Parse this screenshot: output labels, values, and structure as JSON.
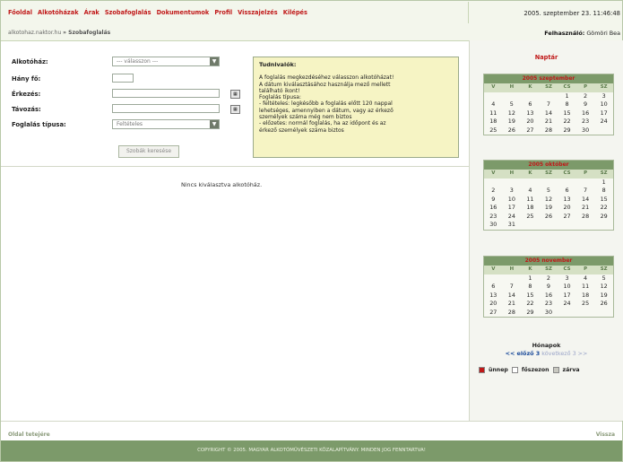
{
  "nav": {
    "items": [
      "Főoldal",
      "Alkotóházak",
      "Árak",
      "Szobafoglalás",
      "Dokumentumok",
      "Profil",
      "Visszajelzés",
      "Kilépés"
    ],
    "datetime": "2005. szeptember 23. 11:46:48"
  },
  "breadcrumb": {
    "path": "alkotohaz.naktor.hu",
    "current": "» Szobafoglalás"
  },
  "user": {
    "label": "Felhasználó:",
    "name": "Gömöri Bea"
  },
  "form": {
    "alkotohaz_label": "Alkotóház:",
    "alkotohaz_value": "--- válasszon ---",
    "hany_fo_label": "Hány fő:",
    "erkezes_label": "Érkezés:",
    "tavozas_label": "Távozás:",
    "foglalas_label": "Foglalás típusa:",
    "foglalas_value": "Feltételes",
    "search_button": "Szobák keresése"
  },
  "info": {
    "title": "Tudnivalók:",
    "lines": [
      "A foglalás megkezdéséhez válasszon alkotóházat!",
      "A dátum kiválasztásához használja mező mellett",
      "található ikont!",
      "Foglalás típusa:",
      "- feltételes: legkésőbb a foglalás előtt 120 nappal",
      "lehetséges, amennyiben a dátum, vagy az érkező",
      "személyek száma még nem biztos",
      "- előzetes: normál foglalás, ha az időpont és az",
      "érkező személyek száma biztos"
    ]
  },
  "main": {
    "no_selection": "Nincs kiválasztva alkotóház."
  },
  "calendar": {
    "title": "Naptár",
    "dow": [
      "V",
      "H",
      "K",
      "SZ",
      "CS",
      "P",
      "SZ"
    ],
    "months": [
      {
        "name": "2005 szeptember",
        "rows": [
          [
            "",
            "",
            "",
            "",
            "1",
            "2",
            "3"
          ],
          [
            "4",
            "5",
            "6",
            "7",
            "8",
            "9",
            "10"
          ],
          [
            "11",
            "12",
            "13",
            "14",
            "15",
            "16",
            "17"
          ],
          [
            "18",
            "19",
            "20",
            "21",
            "22",
            "23",
            "24"
          ],
          [
            "25",
            "26",
            "27",
            "28",
            "29",
            "30",
            ""
          ]
        ]
      },
      {
        "name": "2005 október",
        "rows": [
          [
            "",
            "",
            "",
            "",
            "",
            "",
            "1"
          ],
          [
            "2",
            "3",
            "4",
            "5",
            "6",
            "7",
            "8"
          ],
          [
            "9",
            "10",
            "11",
            "12",
            "13",
            "14",
            "15"
          ],
          [
            "16",
            "17",
            "18",
            "19",
            "20",
            "21",
            "22"
          ],
          [
            "23",
            "24",
            "25",
            "26",
            "27",
            "28",
            "29"
          ],
          [
            "30",
            "31",
            "",
            "",
            "",
            "",
            ""
          ]
        ]
      },
      {
        "name": "2005 november",
        "rows": [
          [
            "",
            "",
            "1",
            "2",
            "3",
            "4",
            "5"
          ],
          [
            "6",
            "7",
            "8",
            "9",
            "10",
            "11",
            "12"
          ],
          [
            "13",
            "14",
            "15",
            "16",
            "17",
            "18",
            "19"
          ],
          [
            "20",
            "21",
            "22",
            "23",
            "24",
            "25",
            "26"
          ],
          [
            "27",
            "28",
            "29",
            "30",
            "",
            "",
            ""
          ]
        ]
      }
    ],
    "months_label": "Hónapok",
    "prev": "<< előző 3",
    "next": "következő 3 >>",
    "legend": [
      {
        "label": "ünnep",
        "color": "#c01818"
      },
      {
        "label": "főszezon",
        "color": "#ffffff"
      },
      {
        "label": "zárva",
        "color": "#c8c8c0"
      }
    ]
  },
  "bottom": {
    "top_link": "Oldal tetejére",
    "back_link": "Vissza",
    "copyright": "COPYRIGHT © 2005. MAGYAR ALKOTÓMŰVÉSZETI KÖZALAPÍTVÁNY. MINDEN JOG FENNTARTVA!"
  },
  "colors": {
    "accent_red": "#c01818",
    "header_green": "#7c9a6a",
    "info_yellow": "#f6f4c4"
  }
}
